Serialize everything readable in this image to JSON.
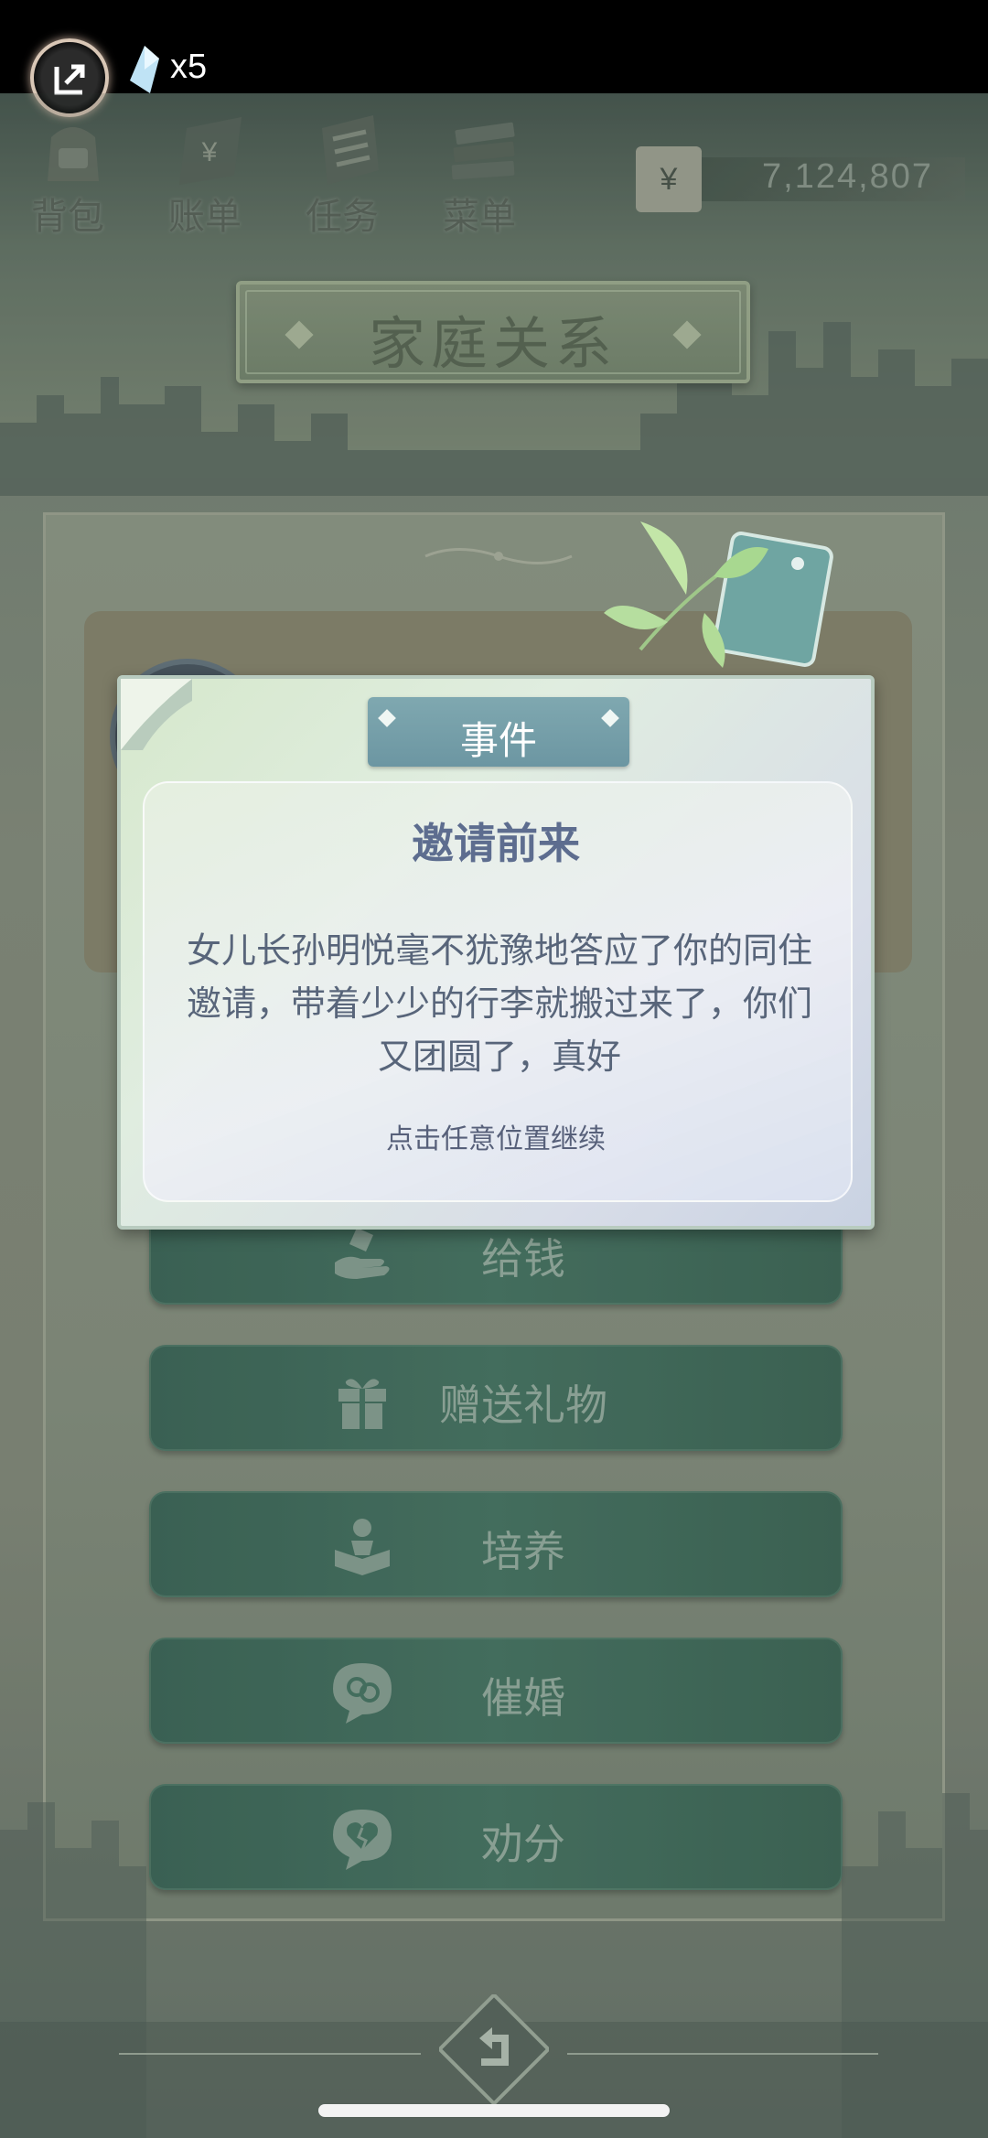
{
  "status_bar": {
    "gem_count": "x5"
  },
  "nav": {
    "items": [
      {
        "label": "背包",
        "icon": "backpack-icon"
      },
      {
        "label": "账单",
        "icon": "bill-icon"
      },
      {
        "label": "任务",
        "icon": "task-icon"
      },
      {
        "label": "菜单",
        "icon": "menu-icon"
      }
    ]
  },
  "money": {
    "currency_symbol": "¥",
    "value": "7,124,807"
  },
  "page_title": "家庭关系",
  "actions": [
    {
      "label": "给钱",
      "icon": "hand-give-icon"
    },
    {
      "label": "赠送礼物",
      "icon": "gift-icon"
    },
    {
      "label": "培养",
      "icon": "reading-person-icon"
    },
    {
      "label": "催婚",
      "icon": "gender-bubble-icon"
    },
    {
      "label": "劝分",
      "icon": "broken-heart-bubble-icon"
    }
  ],
  "dialog": {
    "tab_label": "事件",
    "heading": "邀请前来",
    "body": "女儿长孙明悦毫不犹豫地答应了你的同住邀请，带着少少的行李就搬过来了，你们又团圆了，真好",
    "hint": "点击任意位置继续"
  },
  "colors": {
    "accent_green": "#4a7a68",
    "dialog_tab": "#7fa8b0",
    "heading": "#5d6d8f"
  }
}
